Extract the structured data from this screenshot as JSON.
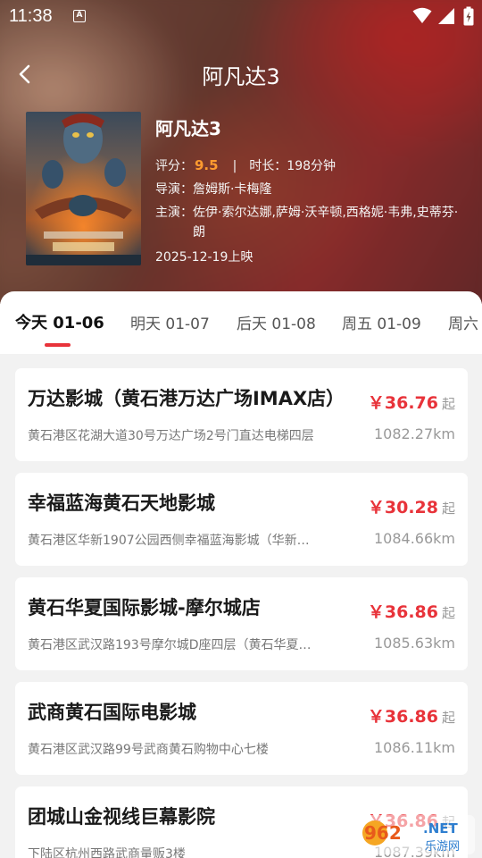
{
  "status_bar": {
    "time": "11:38",
    "icons": [
      "a-notification-icon",
      "wifi-icon",
      "signal-icon",
      "battery-icon"
    ]
  },
  "header": {
    "title": "阿凡达3",
    "back_icon": "chevron-left-icon"
  },
  "movie": {
    "name": "阿凡达3",
    "score_label": "评分：",
    "score": "9.5",
    "separator": "|",
    "duration_label": "时长：",
    "duration": "198分钟",
    "director_label": "导演：",
    "director": "詹姆斯·卡梅隆",
    "cast_label": "主演：",
    "cast": "佐伊·索尔达娜,萨姆·沃辛顿,西格妮·韦弗,史蒂芬·朗",
    "release": "2025-12-19上映"
  },
  "tabs": [
    {
      "label": "今天 01-06",
      "active": true
    },
    {
      "label": "明天 01-07",
      "active": false
    },
    {
      "label": "后天 01-08",
      "active": false
    },
    {
      "label": "周五 01-09",
      "active": false
    },
    {
      "label": "周六",
      "active": false
    }
  ],
  "cinemas": [
    {
      "name": "万达影城（黄石港万达广场IMAX店）",
      "price": "￥36.76",
      "price_suffix": "起",
      "address": "黄石港区花湖大道30号万达广场2号门直达电梯四层",
      "distance": "1082.27km"
    },
    {
      "name": "幸福蓝海黄石天地影城",
      "price": "￥30.28",
      "price_suffix": "起",
      "address": "黄石港区华新1907公园西侧幸福蓝海影城（华新…",
      "distance": "1084.66km"
    },
    {
      "name": "黄石华夏国际影城-摩尔城店",
      "price": "￥36.86",
      "price_suffix": "起",
      "address": "黄石港区武汉路193号摩尔城D座四层（黄石华夏…",
      "distance": "1085.63km"
    },
    {
      "name": "武商黄石国际电影城",
      "price": "￥36.86",
      "price_suffix": "起",
      "address": "黄石港区武汉路99号武商黄石购物中心七楼",
      "distance": "1086.11km"
    },
    {
      "name": "团城山金视线巨幕影院",
      "price": "￥36.86",
      "price_suffix": "起",
      "address": "下陆区杭州西路武商量贩3楼",
      "distance": "1087.39km"
    }
  ],
  "watermark": {
    "text_top": "962",
    "text_net": ".NET",
    "text_bottom": "乐游网"
  },
  "colors": {
    "accent": "#e8333a",
    "score": "#ff9b2f"
  }
}
